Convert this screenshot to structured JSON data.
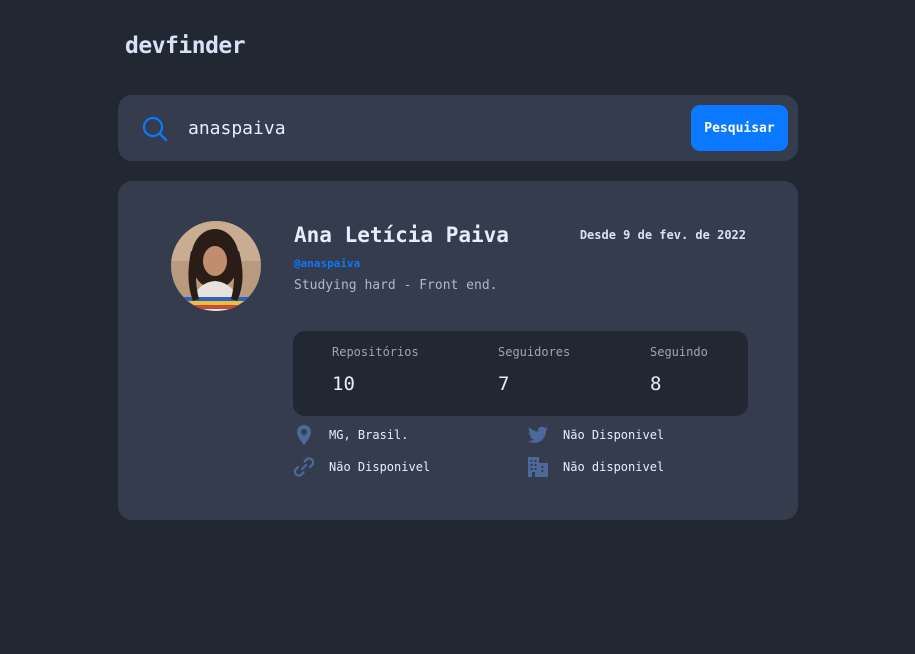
{
  "app": {
    "logo": "devfinder"
  },
  "search": {
    "value": "anaspaiva",
    "button_label": "Pesquisar"
  },
  "profile": {
    "name": "Ana Letícia Paiva",
    "login": "@anaspaiva",
    "joined": "Desde 9 de fev. de 2022",
    "bio": "Studying hard - Front end."
  },
  "stats": [
    {
      "label": "Repositórios",
      "value": "10"
    },
    {
      "label": "Seguidores",
      "value": "7"
    },
    {
      "label": "Seguindo",
      "value": "8"
    }
  ],
  "links": {
    "location": "MG, Brasil.",
    "twitter": "Não Disponivel",
    "blog": "Não Disponivel",
    "company": "Não disponivel"
  },
  "colors": {
    "background": "#212733",
    "card": "#353c4e",
    "accent": "#0a79ff",
    "icon": "#4b6a9b"
  }
}
